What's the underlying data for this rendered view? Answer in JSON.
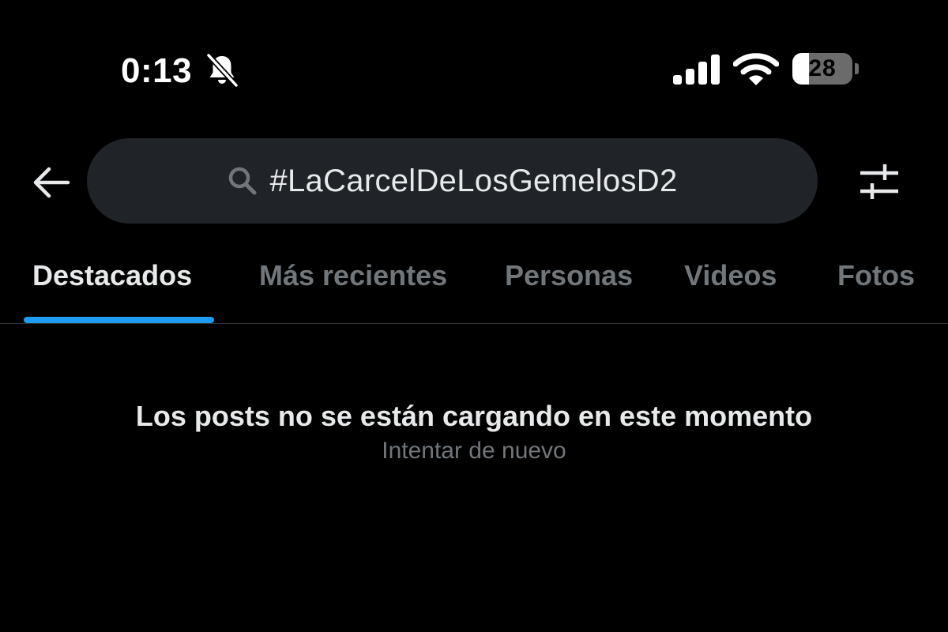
{
  "status_bar": {
    "time": "0:13",
    "battery_level": "28",
    "battery_fraction": 0.28,
    "icons": [
      "bell-slash-icon",
      "cellular-signal-icon",
      "wifi-icon",
      "battery-icon"
    ]
  },
  "header": {
    "back_icon": "arrow-left-icon",
    "search_icon": "search-icon",
    "search_query": "#LaCarcelDeLosGemelosD2",
    "filter_icon": "sliders-icon"
  },
  "tabs": [
    {
      "label": "Destacados",
      "active": true
    },
    {
      "label": "Más recientes",
      "active": false
    },
    {
      "label": "Personas",
      "active": false
    },
    {
      "label": "Videos",
      "active": false
    },
    {
      "label": "Fotos",
      "active": false
    }
  ],
  "empty_state": {
    "title": "Los posts no se están cargando en este momento",
    "retry_label": "Intentar de nuevo"
  },
  "colors": {
    "background": "#000000",
    "search_bg": "#202327",
    "primary_text": "#e7e9ea",
    "secondary_text": "#71767b",
    "accent": "#1d9bf0",
    "divider": "#2f3336"
  }
}
